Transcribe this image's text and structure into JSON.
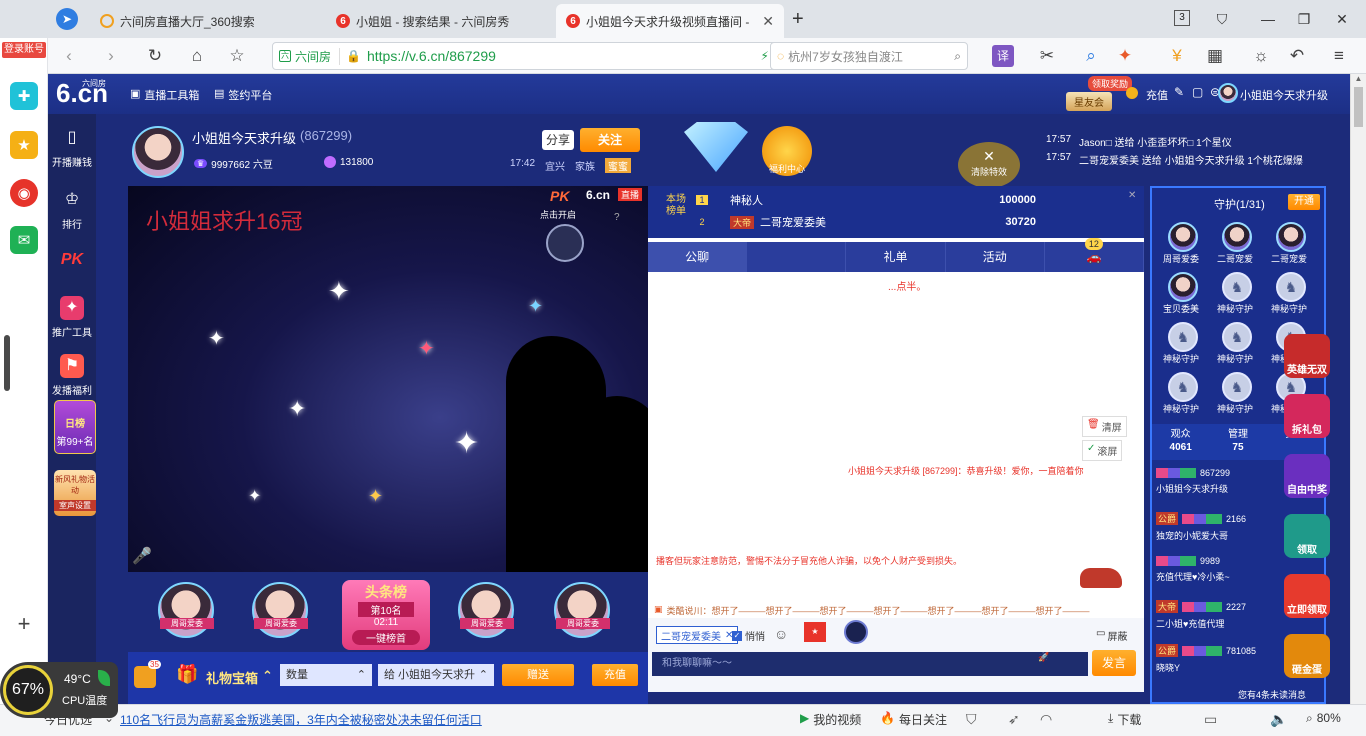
{
  "browser": {
    "tabs": [
      {
        "label": "六间房直播大厅_360搜索",
        "active": false
      },
      {
        "label": "小姐姐 - 搜索结果 - 六间房秀",
        "active": false
      },
      {
        "label": "小姐姐今天求升级视频直播间 -",
        "active": true
      }
    ],
    "tab_count": "3",
    "url_site": "六间房",
    "url": "https://v.6.cn/867299",
    "search_placeholder": "杭州7岁女孩独自渡江"
  },
  "sidebar": {
    "login_label": "登录账号",
    "add_label": "+"
  },
  "site": {
    "logo_top": "六间房",
    "logo": "6.cn",
    "toolbox": "直播工具箱",
    "sign_platform": "签约平台",
    "star_friend": "星友会",
    "receive_bonus": "领取奖励",
    "recharge": "充值",
    "user_name": "小姐姐今天求升级"
  },
  "page_nav": [
    {
      "label": "开播赚钱",
      "icon": "▯"
    },
    {
      "label": "排行",
      "icon": "♔"
    },
    {
      "label": "PK",
      "icon": "PK"
    },
    {
      "label": "推广工具",
      "icon": "✦"
    },
    {
      "label": "发播福利",
      "icon": "⚑"
    },
    {
      "label": "日榜",
      "icon": "♛"
    },
    {
      "label": "第99+名",
      "icon": ""
    },
    {
      "label": "新风礼物活动",
      "icon": "🎁"
    },
    {
      "label": "室声设置",
      "icon": ""
    }
  ],
  "anchor": {
    "name": "小姐姐今天求升级",
    "room_id": "(867299)",
    "beans": "9997662 六豆",
    "coins": "131800",
    "share": "分享",
    "follow": "关注",
    "time": "17:42",
    "city": "宜兴",
    "family": "家族",
    "family_tag": "蜜蜜",
    "welfare": "福利中心",
    "clear_effects": "清除特效"
  },
  "top_notices": [
    {
      "time": "17:57",
      "text": "Jason□ 送给 小歪歪坏坏□ 1个星仪"
    },
    {
      "time": "17:57",
      "text": "二哥宠爱委美 送给 小姐姐今天求升级 1个桃花爆爆"
    }
  ],
  "video": {
    "title_overlay": "小姐姐求升16冠",
    "pk_label": "PK",
    "pk_sub": "点击开启",
    "brand": "6.cn",
    "live": "直播"
  },
  "rank": {
    "label1": "本场",
    "label2": "榜单",
    "entries": [
      {
        "rank": "1",
        "name": "神秘人",
        "score": "100000"
      },
      {
        "rank": "2",
        "badge": "大帝",
        "name": "二哥宠爱委美",
        "score": "30720"
      }
    ]
  },
  "chat": {
    "tabs": [
      "公聊",
      "",
      "礼单",
      "活动"
    ],
    "tab_badge": "12",
    "welcome": "...点半。",
    "clear_screen": "清屏",
    "scroll_screen": "滚屏",
    "message": "小姐姐今天求升级 [867299]：恭喜升级！爱你，一直陪着你",
    "warning": "播客但玩家注意防范，警惕不法分子冒充他人诈骗，以免个人财产受到损失。",
    "ticker": "类酷说川：想开了———想开了———想开了———想开了———想开了———想开了———想开了———",
    "recipient": "二哥宠爱委美",
    "whisper": "悄悄",
    "placeholder": "和我聊聊嘛～～",
    "screen_toggle": "屏蔽",
    "send": "发言",
    "voice": "语音"
  },
  "guard": {
    "title": "守护(1/31)",
    "open": "开通",
    "members": [
      {
        "name": "周哥爱委",
        "locked": false
      },
      {
        "name": "二哥宠爱",
        "locked": false
      },
      {
        "name": "二哥宠爱",
        "locked": false
      },
      {
        "name": "宝贝委美",
        "locked": false
      },
      {
        "name": "神秘守护",
        "locked": true
      },
      {
        "name": "神秘守护",
        "locked": true
      },
      {
        "name": "神秘守护",
        "locked": true
      },
      {
        "name": "神秘守护",
        "locked": true
      },
      {
        "name": "神秘守护",
        "locked": true
      },
      {
        "name": "神秘守护",
        "locked": true
      },
      {
        "name": "神秘守护",
        "locked": true
      },
      {
        "name": "神秘守护",
        "locked": true
      }
    ],
    "stats": [
      {
        "label": "观众",
        "value": "4061"
      },
      {
        "label": "管理",
        "value": "75"
      },
      {
        "label": "麦序",
        "value": ""
      }
    ],
    "viewers": [
      {
        "badge": "",
        "name": "867299",
        "sub": "小姐姐今天求升级"
      },
      {
        "badge": "公爵",
        "name": "2166",
        "sub": "独宠的小妮爱大哥"
      },
      {
        "badge": "",
        "name": "9989",
        "sub": "充值代理♥冷小柔~"
      },
      {
        "badge": "大帝",
        "name": "2227",
        "sub": "二小姐♥充值代理"
      },
      {
        "badge": "公爵",
        "name": "781085",
        "sub": "晓晓Y"
      }
    ],
    "queue_notice": "您有4条未读消息"
  },
  "promos": [
    {
      "label": "英雄无双",
      "color": "#c62b2b"
    },
    {
      "label": "拆礼包",
      "color": "#d4285c"
    },
    {
      "label": "自由中奖",
      "color": "#6a2fbf"
    },
    {
      "label": "领取",
      "color": "#1f9a8a"
    },
    {
      "label": "立即领取",
      "color": "#e63a2d"
    },
    {
      "label": "砸金蛋",
      "color": "#e3890c"
    }
  ],
  "fans": [
    {
      "name": "周哥爱委"
    },
    {
      "name": "周哥爱委"
    },
    {
      "name": "周哥爱委"
    },
    {
      "name": "周哥爱委"
    }
  ],
  "headline": {
    "title": "头条榜",
    "rank": "第10名",
    "time": "02:11",
    "action": "一键榜首"
  },
  "giftbar": {
    "badge": "35",
    "gift_box": "礼物宝箱",
    "quantity": "数量",
    "to": "给 小姐姐今天求升",
    "give": "赠送",
    "recharge": "充值"
  },
  "statusbar": {
    "news": "110名飞行员为高薪奚金叛逃美国，3年内全被秘密处决未留任何活口",
    "prefix": "今日优选",
    "my_video": "我的视频",
    "daily": "每日关注",
    "download": "下载",
    "zoom": "80%"
  },
  "cpu": {
    "percent": "67%",
    "temp": "49°C",
    "label": "CPU温度"
  }
}
